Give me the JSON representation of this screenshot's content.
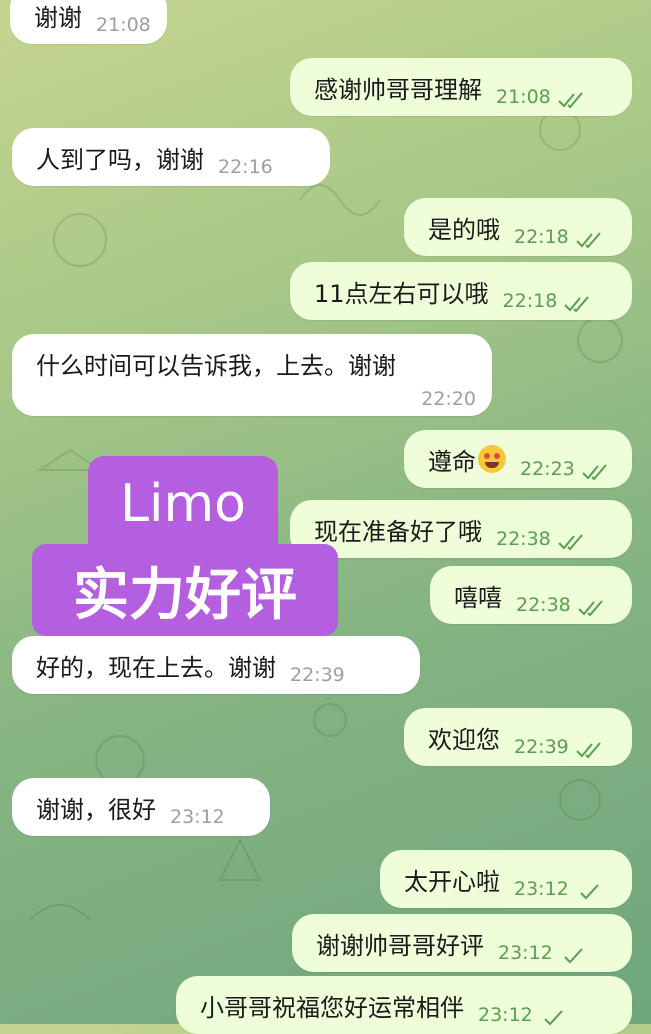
{
  "messages": [
    {
      "text": "谢谢",
      "time": "21:08",
      "dir": "in"
    },
    {
      "text": "感谢帅哥哥理解",
      "time": "21:08",
      "dir": "out",
      "status": "read"
    },
    {
      "text": "人到了吗，谢谢",
      "time": "22:16",
      "dir": "in"
    },
    {
      "text": "是的哦",
      "time": "22:18",
      "dir": "out",
      "status": "read"
    },
    {
      "text": "11点左右可以哦",
      "time": "22:18",
      "dir": "out",
      "status": "read"
    },
    {
      "text": "什么时间可以告诉我，上去。谢谢",
      "time": "22:20",
      "dir": "in"
    },
    {
      "text": "遵命",
      "time": "22:23",
      "dir": "out",
      "status": "read",
      "emoji": "star-struck-emoji"
    },
    {
      "text": "现在准备好了哦",
      "time": "22:38",
      "dir": "out",
      "status": "read"
    },
    {
      "text": "嘻嘻",
      "time": "22:38",
      "dir": "out",
      "status": "read"
    },
    {
      "text": "好的，现在上去。谢谢",
      "time": "22:39",
      "dir": "in"
    },
    {
      "text": "欢迎您",
      "time": "22:39",
      "dir": "out",
      "status": "read"
    },
    {
      "text": "谢谢，很好",
      "time": "23:12",
      "dir": "in"
    },
    {
      "text": "太开心啦",
      "time": "23:12",
      "dir": "out",
      "status": "sent"
    },
    {
      "text": "谢谢帅哥哥好评",
      "time": "23:12",
      "dir": "out",
      "status": "sent"
    },
    {
      "text": "小哥哥祝福您好运常相伴",
      "time": "23:12",
      "dir": "out",
      "status": "sent"
    }
  ],
  "overlay": {
    "line1": "Limo",
    "line2": "实力好评",
    "color": "#b35fe0"
  },
  "colors": {
    "incoming_bubble": "#ffffff",
    "outgoing_bubble": "#eefed8",
    "check": "#5b9e4f"
  }
}
